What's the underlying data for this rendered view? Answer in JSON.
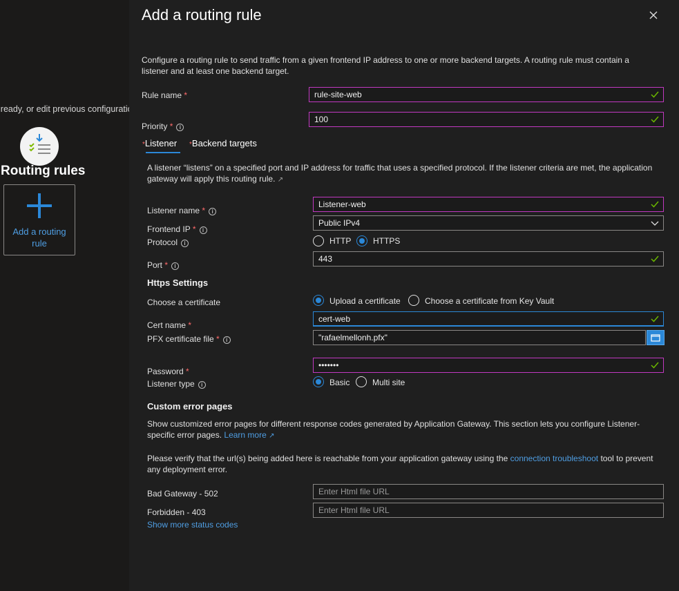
{
  "background": {
    "partial_text": "lready, or edit previous configuratio",
    "routing_rules_title": "Routing rules",
    "add_routing_rule_label": "Add a routing rule"
  },
  "panel": {
    "title": "Add a routing rule",
    "description": "Configure a routing rule to send traffic from a given frontend IP address to one or more backend targets. A routing rule must contain a listener and at least one backend target.",
    "rule_name_label": "Rule name",
    "rule_name_value": "rule-site-web",
    "priority_label": "Priority",
    "priority_value": "100",
    "tabs": [
      {
        "label": "Listener",
        "required": "*",
        "active": true
      },
      {
        "label": "Backend targets",
        "required": "*",
        "active": false
      }
    ],
    "listener_description": "A listener “listens” on a specified port and IP address for traffic that uses a specified protocol. If the listener criteria are met, the application gateway will apply this routing rule.",
    "listener_name_label": "Listener name",
    "listener_name_value": "Listener-web",
    "frontend_ip_label": "Frontend IP",
    "frontend_ip_value": "Public IPv4",
    "protocol_label": "Protocol",
    "protocol_options": [
      "HTTP",
      "HTTPS"
    ],
    "protocol_selected": "HTTPS",
    "port_label": "Port",
    "port_value": "443",
    "https_settings_title": "Https Settings",
    "choose_cert_label": "Choose a certificate",
    "cert_options": [
      "Upload a certificate",
      "Choose a certificate from Key Vault"
    ],
    "cert_selected": "Upload a certificate",
    "cert_name_label": "Cert name",
    "cert_name_value": "cert-web",
    "pfx_label": "PFX certificate file",
    "pfx_value": "\"rafaelmellonh.pfx\"",
    "password_label": "Password",
    "password_value": "•••••••",
    "listener_type_label": "Listener type",
    "listener_type_options": [
      "Basic",
      "Multi site"
    ],
    "listener_type_selected": "Basic",
    "custom_error_title": "Custom error pages",
    "custom_error_description": "Show customized error pages for different response codes generated by Application Gateway. This section lets you configure Listener-specific error pages.",
    "learn_more": "Learn more",
    "verify_text_before": "Please verify that the url(s) being added here is reachable from your application gateway using the",
    "verify_link": "connection troubleshoot",
    "verify_text_after": "tool to prevent any deployment error.",
    "bad_gateway_label": "Bad Gateway - 502",
    "forbidden_label": "Forbidden - 403",
    "html_url_placeholder": "Enter Html file URL",
    "show_more": "Show more status codes"
  },
  "colors": {
    "accent": "#2b88d8",
    "required": "#ff6b6b",
    "valid_border": "#c239c2",
    "check": "#6bb700"
  }
}
